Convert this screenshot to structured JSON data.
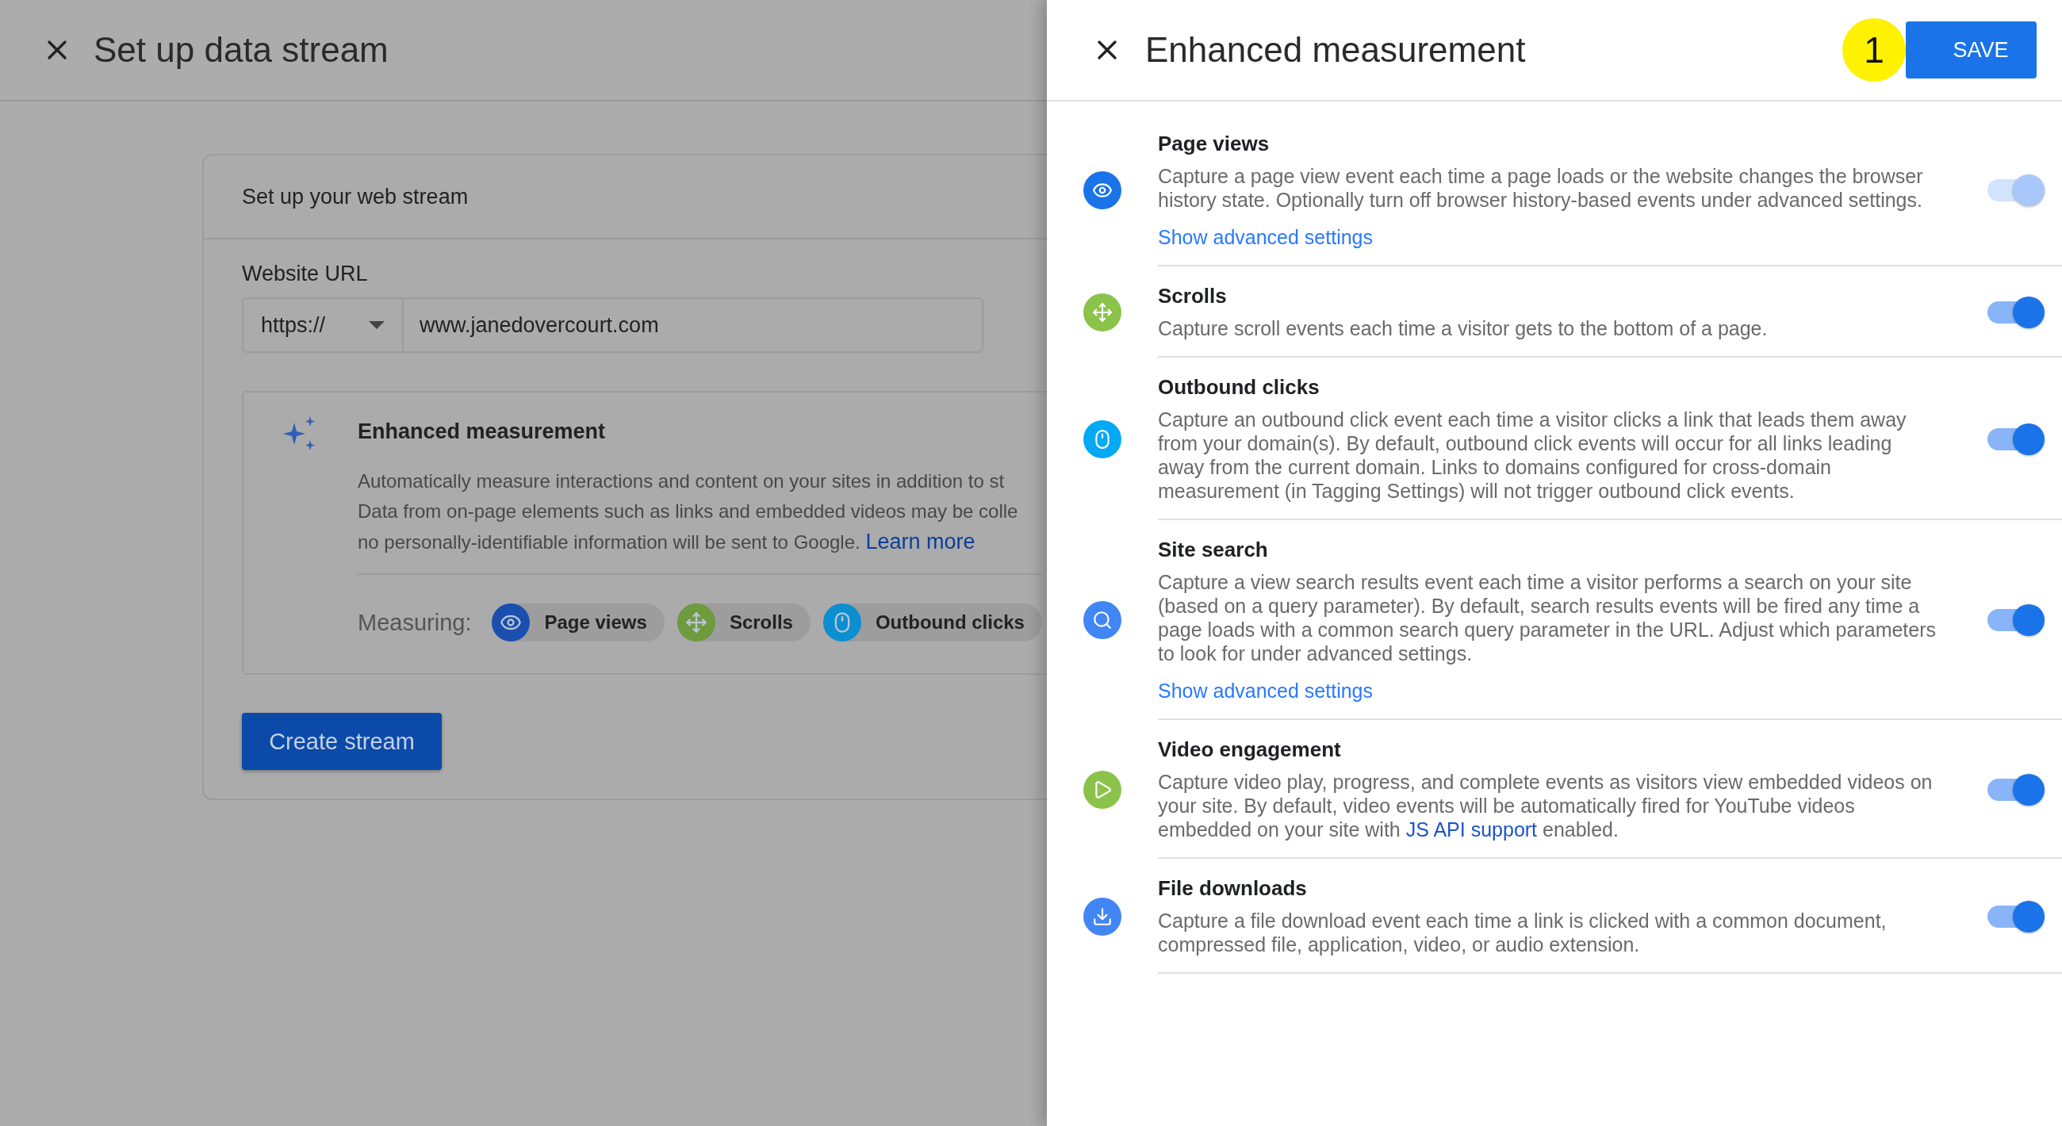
{
  "background_page": {
    "title": "Set up data stream",
    "card": {
      "title": "Set up your web stream",
      "url_label": "Website URL",
      "protocol": "https://",
      "url": "www.janedovercourt.com",
      "enhanced": {
        "title": "Enhanced measurement",
        "lines": [
          {
            "text": "Automatically measure interactions and content on your sites in addition to st"
          },
          {
            "text": "Data from on-page elements such as links and embedded videos may be colle"
          },
          {
            "text": "no personally-identifiable information will be sent to Google.",
            "link": "Learn more"
          }
        ],
        "measuring_label": "Measuring:",
        "chips": [
          {
            "kind": "eye",
            "label": "Page views"
          },
          {
            "kind": "scroll",
            "label": "Scrolls"
          },
          {
            "kind": "mouse",
            "label": "Outbound clicks"
          }
        ]
      },
      "button": "Create stream"
    }
  },
  "panel": {
    "title": "Enhanced measurement",
    "step_badge": "1",
    "save": "SAVE",
    "settings": [
      {
        "kind": "eye",
        "title": "Page views",
        "description": [
          {
            "text": "Capture a page view event each time a page loads or the website changes the browser history state. Optionally turn off browser history-based events under advanced settings."
          }
        ],
        "link": "Show advanced settings",
        "on": true,
        "disabled": true
      },
      {
        "kind": "scroll",
        "title": "Scrolls",
        "description": [
          {
            "text": "Capture scroll events each time a visitor gets to the bottom of a page."
          }
        ],
        "on": true,
        "disabled": false
      },
      {
        "kind": "mouse",
        "title": "Outbound clicks",
        "description": [
          {
            "text": "Capture an outbound click event each time a visitor clicks a link that leads them away from your domain(s). By default, outbound click events will occur for all links leading away from the current domain. Links to domains configured for cross-domain measurement (in Tagging Settings) will not trigger outbound click events."
          }
        ],
        "on": true,
        "disabled": false
      },
      {
        "kind": "search",
        "title": "Site search",
        "description": [
          {
            "text": "Capture a view search results event each time a visitor performs a search on your site (based on a query parameter). By default, search results events will be fired any time a page loads with a common search query parameter in the URL. Adjust which parameters to look for under advanced settings."
          }
        ],
        "link": "Show advanced settings",
        "on": true,
        "disabled": false
      },
      {
        "kind": "video",
        "title": "Video engagement",
        "description": [
          {
            "text": "Capture video play, progress, and complete events as visitors view embedded videos on your site. By default, video events will be automatically fired for YouTube videos embedded on your site with "
          },
          {
            "link": "JS API support"
          },
          {
            "text": " enabled."
          }
        ],
        "on": true,
        "disabled": false
      },
      {
        "kind": "download",
        "title": "File downloads",
        "description": [
          {
            "text": "Capture a file download event each time a link is clicked with a common document, compressed file, application, video, or audio extension."
          }
        ],
        "on": true,
        "disabled": false
      }
    ]
  }
}
